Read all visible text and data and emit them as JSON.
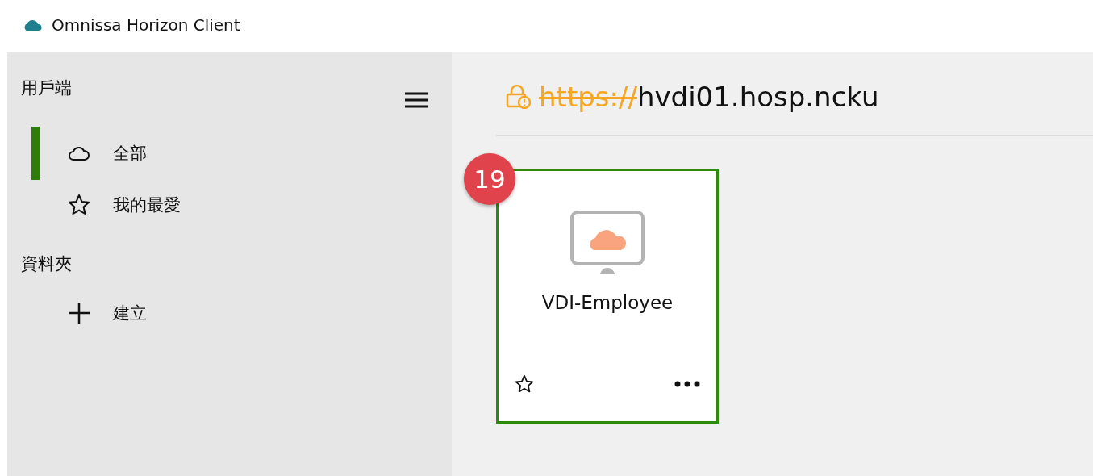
{
  "window": {
    "title": "Omnissa Horizon Client"
  },
  "sidebar": {
    "sections": [
      {
        "heading": "用戶端",
        "items": [
          {
            "kind": "cloud",
            "label": "全部",
            "selected": true
          },
          {
            "kind": "star",
            "label": "我的最愛",
            "selected": false
          }
        ]
      },
      {
        "heading": "資料夾",
        "items": [
          {
            "kind": "plus",
            "label": "建立",
            "selected": false
          }
        ]
      }
    ]
  },
  "address": {
    "scheme": "https://",
    "host": "hvdi01.hosp.ncku",
    "secure": false
  },
  "desktops": [
    {
      "name": "VDI-Employee",
      "badge": "19",
      "selected": true,
      "favorite": false
    }
  ]
}
